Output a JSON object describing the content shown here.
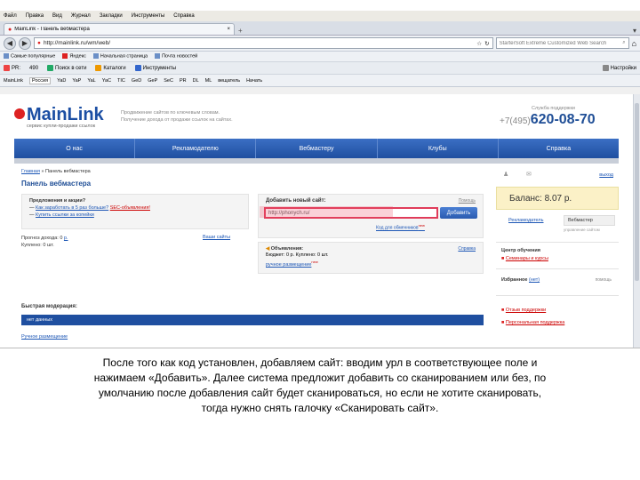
{
  "browser": {
    "menu": [
      "Файл",
      "Правка",
      "Вид",
      "Журнал",
      "Закладки",
      "Инструменты",
      "Справка"
    ],
    "tab_label": "MainLink - Панель вебмастера",
    "url": "http://mainlink.ru/wm/web/",
    "search_placeholder": "StarterSoft Extreme Customized Web Search",
    "bookmarks": [
      "Самые популярные",
      "Яндекс",
      "Начальная страница",
      "Почта новостей"
    ],
    "toolbar1": {
      "pr": "PR:",
      "count": "490",
      "ask": "Поиск в сети",
      "catalog": "Каталоги",
      "tools": "Инструменты",
      "settings": "Настройки"
    },
    "toolbar2": [
      "MainLink",
      "Россия",
      "YaD",
      "YaP",
      "YaL",
      "YaC",
      "TIC",
      "GeD",
      "GeP",
      "SeC",
      "PR",
      "DL",
      "ML",
      "вещатель",
      "Начать"
    ]
  },
  "site": {
    "logo": "MainLink",
    "logo_sub": "сервис купли-продажи ссылок",
    "tagline": [
      "Продвижение сайтов по ключевым словам.",
      "Получение дохода от продажи ссылок на сайтах."
    ],
    "support_title": "Служба поддержки",
    "phone_code": "+7(495)",
    "phone": "620-08-70",
    "nav": [
      "О нас",
      "Рекламодателю",
      "Вебмастеру",
      "Клубы",
      "Справка"
    ],
    "breadcrumb_home": "Главная",
    "breadcrumb_current": "» Панель вебмастера",
    "page_title": "Панель вебмастера",
    "promo": {
      "heading": "Предложения и акции?",
      "line1_prefix": "— ",
      "line1": "Как заработать в 5 раз больше?",
      "line1_hot": "SEC-объявления!",
      "line2_prefix": "— ",
      "line2": "Купить ссылки за копейки"
    },
    "stats": {
      "forecast": "Прогноз дохода: 0",
      "forecast_link": "р.",
      "bought": "Куплено: 0 шт.",
      "all_sites": "Ваши сайты"
    },
    "add_site": {
      "title": "Добавить новый сайт:",
      "help": "Помощь",
      "input_value": "http://phonych.ru/",
      "button": "Добавить",
      "scan": "",
      "for_clients": "Код для обменников",
      "new": "new"
    },
    "ads": {
      "heading": "Объявления:",
      "archive": "Справка",
      "line": "Бюджет: 0 р. Куплено: 0 шт.",
      "link": "ручное размещение",
      "new": "new"
    },
    "quick": {
      "title": "Быстрая модерация:",
      "bar": "нет данных",
      "manual": "Ручное размещение"
    },
    "right": {
      "exit": "выход",
      "balance": "Баланс: 8.07 р.",
      "tab1": "Рекламодатель",
      "tab2": "Вебмастер",
      "note": "управление сайтом",
      "learn_title": "Центр обучения",
      "learn_link": "Семинары и курсы",
      "favorites": "Избранное",
      "favorites_link": "(нет)",
      "favorites_right": "помощь",
      "support": "Отзыв поддержки",
      "support2": "Персональная поддержка"
    }
  },
  "caption": [
    "После того как код установлен, добавляем сайт: вводим урл в соответствующее поле и",
    "нажимаем «Добавить». Далее система предложит добавить со сканированием или без, по",
    "умолчанию после добавления сайт будет сканироваться, но если не хотите сканировать,",
    "тогда нужно снять галочку «Сканировать сайт»."
  ]
}
